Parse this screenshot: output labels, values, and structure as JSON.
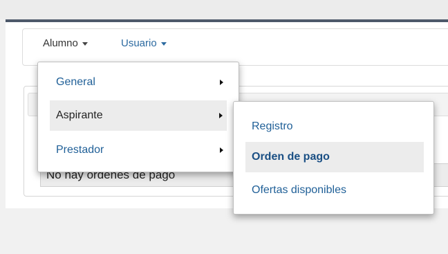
{
  "navbar": {
    "menus": [
      {
        "label": "Alumno"
      },
      {
        "label": "Usuario"
      }
    ]
  },
  "content": {
    "alert_text": "No hay ordenes de pago"
  },
  "dropdown_alumno": {
    "items": [
      {
        "label": "General"
      },
      {
        "label": "Aspirante"
      },
      {
        "label": "Prestador"
      }
    ]
  },
  "submenu_aspirante": {
    "items": [
      {
        "label": "Registro"
      },
      {
        "label": "Orden de pago"
      },
      {
        "label": "Ofertas disponibles"
      }
    ]
  },
  "colors": {
    "link": "#1f5f97",
    "topbar": "#4d596a",
    "hover_bg": "#ececec"
  }
}
